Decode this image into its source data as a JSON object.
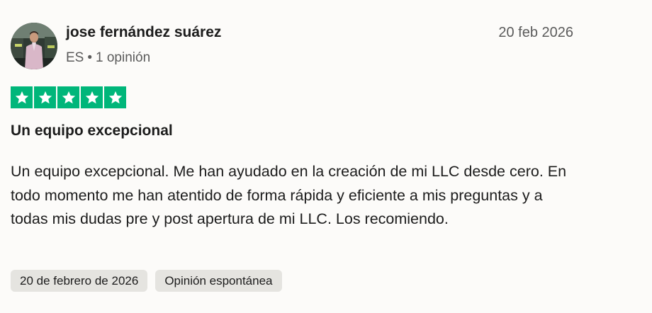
{
  "reviewer": {
    "name": "jose fernández suárez",
    "country": "ES",
    "separator": "•",
    "review_count": "1 opinión",
    "avatar_icon": "profile-photo"
  },
  "review": {
    "date": "20 feb 2026",
    "rating": 5,
    "max_rating": 5,
    "star_color": "#00b67a",
    "title": "Un equipo excepcional",
    "body": "Un equipo excepcional. Me han ayudado en la creación de mi LLC desde cero. En todo momento me han atentido de forma rápida y eficiente a mis preguntas y a todas mis dudas pre y post apertura de mi LLC. Los recomiendo.",
    "tags": {
      "experience_date": "20 de febrero de 2026",
      "review_type": "Opinión espontánea"
    }
  }
}
